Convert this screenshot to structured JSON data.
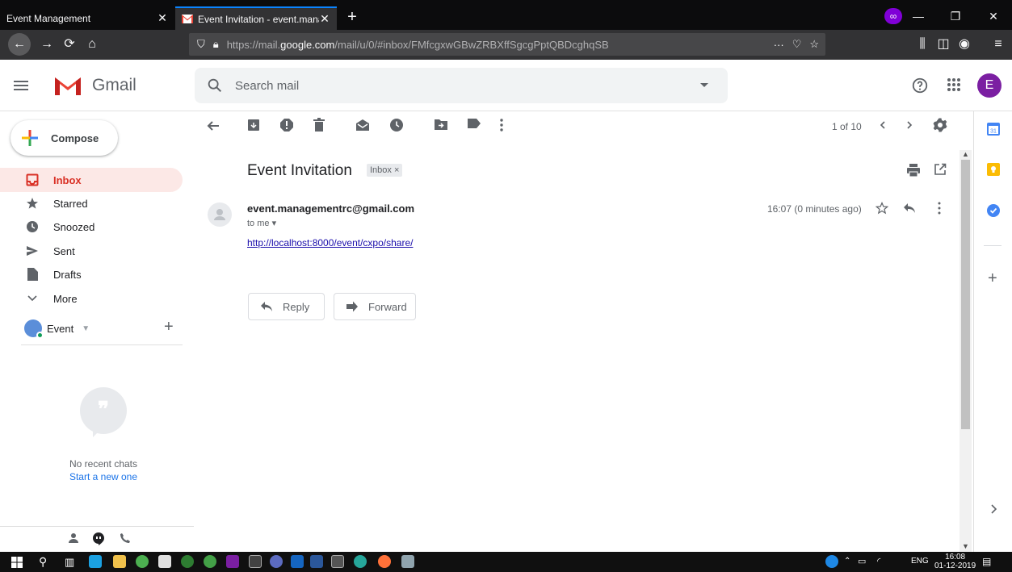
{
  "browser": {
    "tabs": [
      {
        "title": "Event Management",
        "close": "✕"
      },
      {
        "title": "Event Invitation - event.manag",
        "close": "✕"
      }
    ],
    "new_tab": "+",
    "url_prefix": "https://mail.",
    "url_host": "google.com",
    "url_path": "/mail/u/0/#inbox/FMfcgxwGBwZRBXffSgcgPptQBDcghqSB",
    "url_more": "···"
  },
  "gmail": {
    "app_name": "Gmail",
    "search_placeholder": "Search mail",
    "avatar_letter": "E",
    "compose_label": "Compose",
    "nav": [
      {
        "label": "Inbox",
        "icon": "inbox-icon"
      },
      {
        "label": "Starred",
        "icon": "star-icon"
      },
      {
        "label": "Snoozed",
        "icon": "clock-icon"
      },
      {
        "label": "Sent",
        "icon": "send-icon"
      },
      {
        "label": "Drafts",
        "icon": "draft-icon"
      },
      {
        "label": "More",
        "icon": "chevron-down-icon"
      }
    ],
    "hangouts_user": "Event",
    "no_chats": "No recent chats",
    "start_new": "Start a new one",
    "pager": "1 of 10",
    "subject": "Event Invitation",
    "label_chip": "Inbox ×",
    "sender": "event.managementrc@gmail.com",
    "recipient": "to me ▾",
    "body_link": "http://localhost:8000/event/cxpo/share/",
    "timestamp": "16:07 (0 minutes ago)",
    "reply_label": "Reply",
    "forward_label": "Forward"
  },
  "taskbar": {
    "language": "ENG",
    "time": "16:08",
    "date": "01-12-2019"
  },
  "colors": {
    "accent_red": "#d93025",
    "inbox_highlight": "#fce8e6",
    "avatar_purple": "#7b1fa2",
    "link_blue": "#1a73e8"
  }
}
